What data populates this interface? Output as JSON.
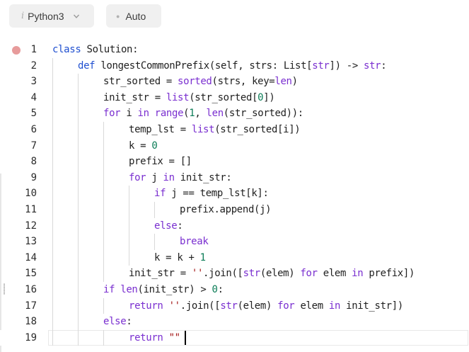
{
  "toolbar": {
    "language_label": "Python3",
    "language_icon": "info-italic-icon",
    "auto_label": "Auto"
  },
  "editor": {
    "breakpoint_line": 1,
    "active_line": 19,
    "lines": [
      {
        "n": "1",
        "indent": 0,
        "tokens": [
          [
            "kw2",
            "class"
          ],
          [
            "",
            "Solution:"
          ]
        ]
      },
      {
        "n": "2",
        "indent": 1,
        "tokens": [
          [
            "kw2",
            "def"
          ],
          [
            "",
            "longestCommonPrefix(self, strs: List["
          ],
          [
            "bi",
            "str"
          ],
          [
            "",
            "]) -> "
          ],
          [
            "bi",
            "str"
          ],
          [
            "",
            ":"
          ]
        ]
      },
      {
        "n": "3",
        "indent": 2,
        "tokens": [
          [
            "",
            "str_sorted = "
          ],
          [
            "bi",
            "sorted"
          ],
          [
            "",
            "(strs, key="
          ],
          [
            "bi",
            "len"
          ],
          [
            "",
            ")"
          ]
        ]
      },
      {
        "n": "4",
        "indent": 2,
        "tokens": [
          [
            "",
            "init_str = "
          ],
          [
            "bi",
            "list"
          ],
          [
            "",
            "(str_sorted["
          ],
          [
            "num",
            "0"
          ],
          [
            "",
            "])"
          ]
        ]
      },
      {
        "n": "5",
        "indent": 2,
        "tokens": [
          [
            "kw",
            "for"
          ],
          [
            "",
            " i "
          ],
          [
            "kw",
            "in"
          ],
          [
            "",
            " "
          ],
          [
            "bi",
            "range"
          ],
          [
            "",
            "("
          ],
          [
            "num",
            "1"
          ],
          [
            "",
            ", "
          ],
          [
            "bi",
            "len"
          ],
          [
            "",
            "(str_sorted)):"
          ]
        ]
      },
      {
        "n": "6",
        "indent": 3,
        "tokens": [
          [
            "",
            "temp_lst = "
          ],
          [
            "bi",
            "list"
          ],
          [
            "",
            "(str_sorted[i])"
          ]
        ]
      },
      {
        "n": "7",
        "indent": 3,
        "tokens": [
          [
            "",
            "k = "
          ],
          [
            "num",
            "0"
          ]
        ]
      },
      {
        "n": "8",
        "indent": 3,
        "tokens": [
          [
            "",
            "prefix = []"
          ]
        ]
      },
      {
        "n": "9",
        "indent": 3,
        "tokens": [
          [
            "kw",
            "for"
          ],
          [
            "",
            " j "
          ],
          [
            "kw",
            "in"
          ],
          [
            "",
            " init_str:"
          ]
        ]
      },
      {
        "n": "10",
        "indent": 4,
        "tokens": [
          [
            "kw",
            "if"
          ],
          [
            "",
            " j == temp_lst[k]:"
          ]
        ]
      },
      {
        "n": "11",
        "indent": 5,
        "tokens": [
          [
            "",
            "prefix.append(j)"
          ]
        ]
      },
      {
        "n": "12",
        "indent": 4,
        "tokens": [
          [
            "kw",
            "else"
          ],
          [
            "",
            ":"
          ]
        ]
      },
      {
        "n": "13",
        "indent": 5,
        "tokens": [
          [
            "kw",
            "break"
          ]
        ]
      },
      {
        "n": "14",
        "indent": 4,
        "tokens": [
          [
            "",
            "k = k + "
          ],
          [
            "num",
            "1"
          ]
        ]
      },
      {
        "n": "15",
        "indent": 3,
        "tokens": [
          [
            "",
            "init_str = "
          ],
          [
            "str",
            "''"
          ],
          [
            "",
            ".join(["
          ],
          [
            "bi",
            "str"
          ],
          [
            "",
            "(elem) "
          ],
          [
            "kw",
            "for"
          ],
          [
            "",
            " elem "
          ],
          [
            "kw",
            "in"
          ],
          [
            "",
            " prefix])"
          ]
        ]
      },
      {
        "n": "16",
        "indent": 2,
        "tokens": [
          [
            "kw",
            "if"
          ],
          [
            "",
            " "
          ],
          [
            "bi",
            "len"
          ],
          [
            "",
            "(init_str) > "
          ],
          [
            "num",
            "0"
          ],
          [
            "",
            ":"
          ]
        ]
      },
      {
        "n": "17",
        "indent": 3,
        "tokens": [
          [
            "kw",
            "return"
          ],
          [
            "",
            " "
          ],
          [
            "str",
            "''"
          ],
          [
            "",
            ".join(["
          ],
          [
            "bi",
            "str"
          ],
          [
            "",
            "(elem) "
          ],
          [
            "kw",
            "for"
          ],
          [
            "",
            " elem "
          ],
          [
            "kw",
            "in"
          ],
          [
            "",
            " init_str])"
          ]
        ]
      },
      {
        "n": "18",
        "indent": 2,
        "tokens": [
          [
            "kw",
            "else"
          ],
          [
            "",
            ":"
          ]
        ]
      },
      {
        "n": "19",
        "indent": 3,
        "tokens": [
          [
            "kw",
            "return"
          ],
          [
            "",
            " "
          ],
          [
            "str",
            "\"\""
          ]
        ]
      }
    ]
  }
}
